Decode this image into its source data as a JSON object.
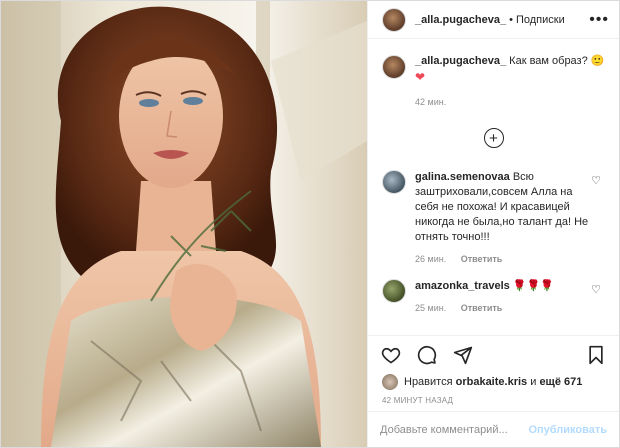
{
  "header": {
    "username": "_alla.pugacheva_",
    "separator": "•",
    "follow_label": "Подписки",
    "more_icon": "more-options-icon"
  },
  "caption": {
    "username": "_alla.pugacheva_",
    "text": "Как вам образ? 🙂",
    "heart": "❤",
    "time": "42 мин."
  },
  "load_more_icon": "plus-circle-icon",
  "comments": [
    {
      "username": "galina.semenovaa",
      "text": "Всю заштриховали,совсем Алла на себя не похожа! И красавицей никогда не была,но талант да! Не отнять точно!!!",
      "time": "26 мин.",
      "reply_label": "Ответить"
    },
    {
      "username": "amazonka_travels",
      "text": "🌹🌹🌹",
      "time": "25 мин.",
      "reply_label": "Ответить"
    }
  ],
  "actions": [
    "heart-icon",
    "comment-icon",
    "share-icon",
    "bookmark-icon"
  ],
  "likes": {
    "prefix": "Нравится",
    "user": "orbakaite.kris",
    "conj": "и",
    "others": "ещё 671"
  },
  "posted_ago": "42 МИНУТ НАЗАД",
  "add_comment": {
    "placeholder": "Добавьте комментарий...",
    "publish_label": "Опубликовать"
  },
  "colors": {
    "link_blue_disabled": "#b3dbff",
    "like_red": "#ed4956",
    "muted": "#8e8e8e"
  }
}
